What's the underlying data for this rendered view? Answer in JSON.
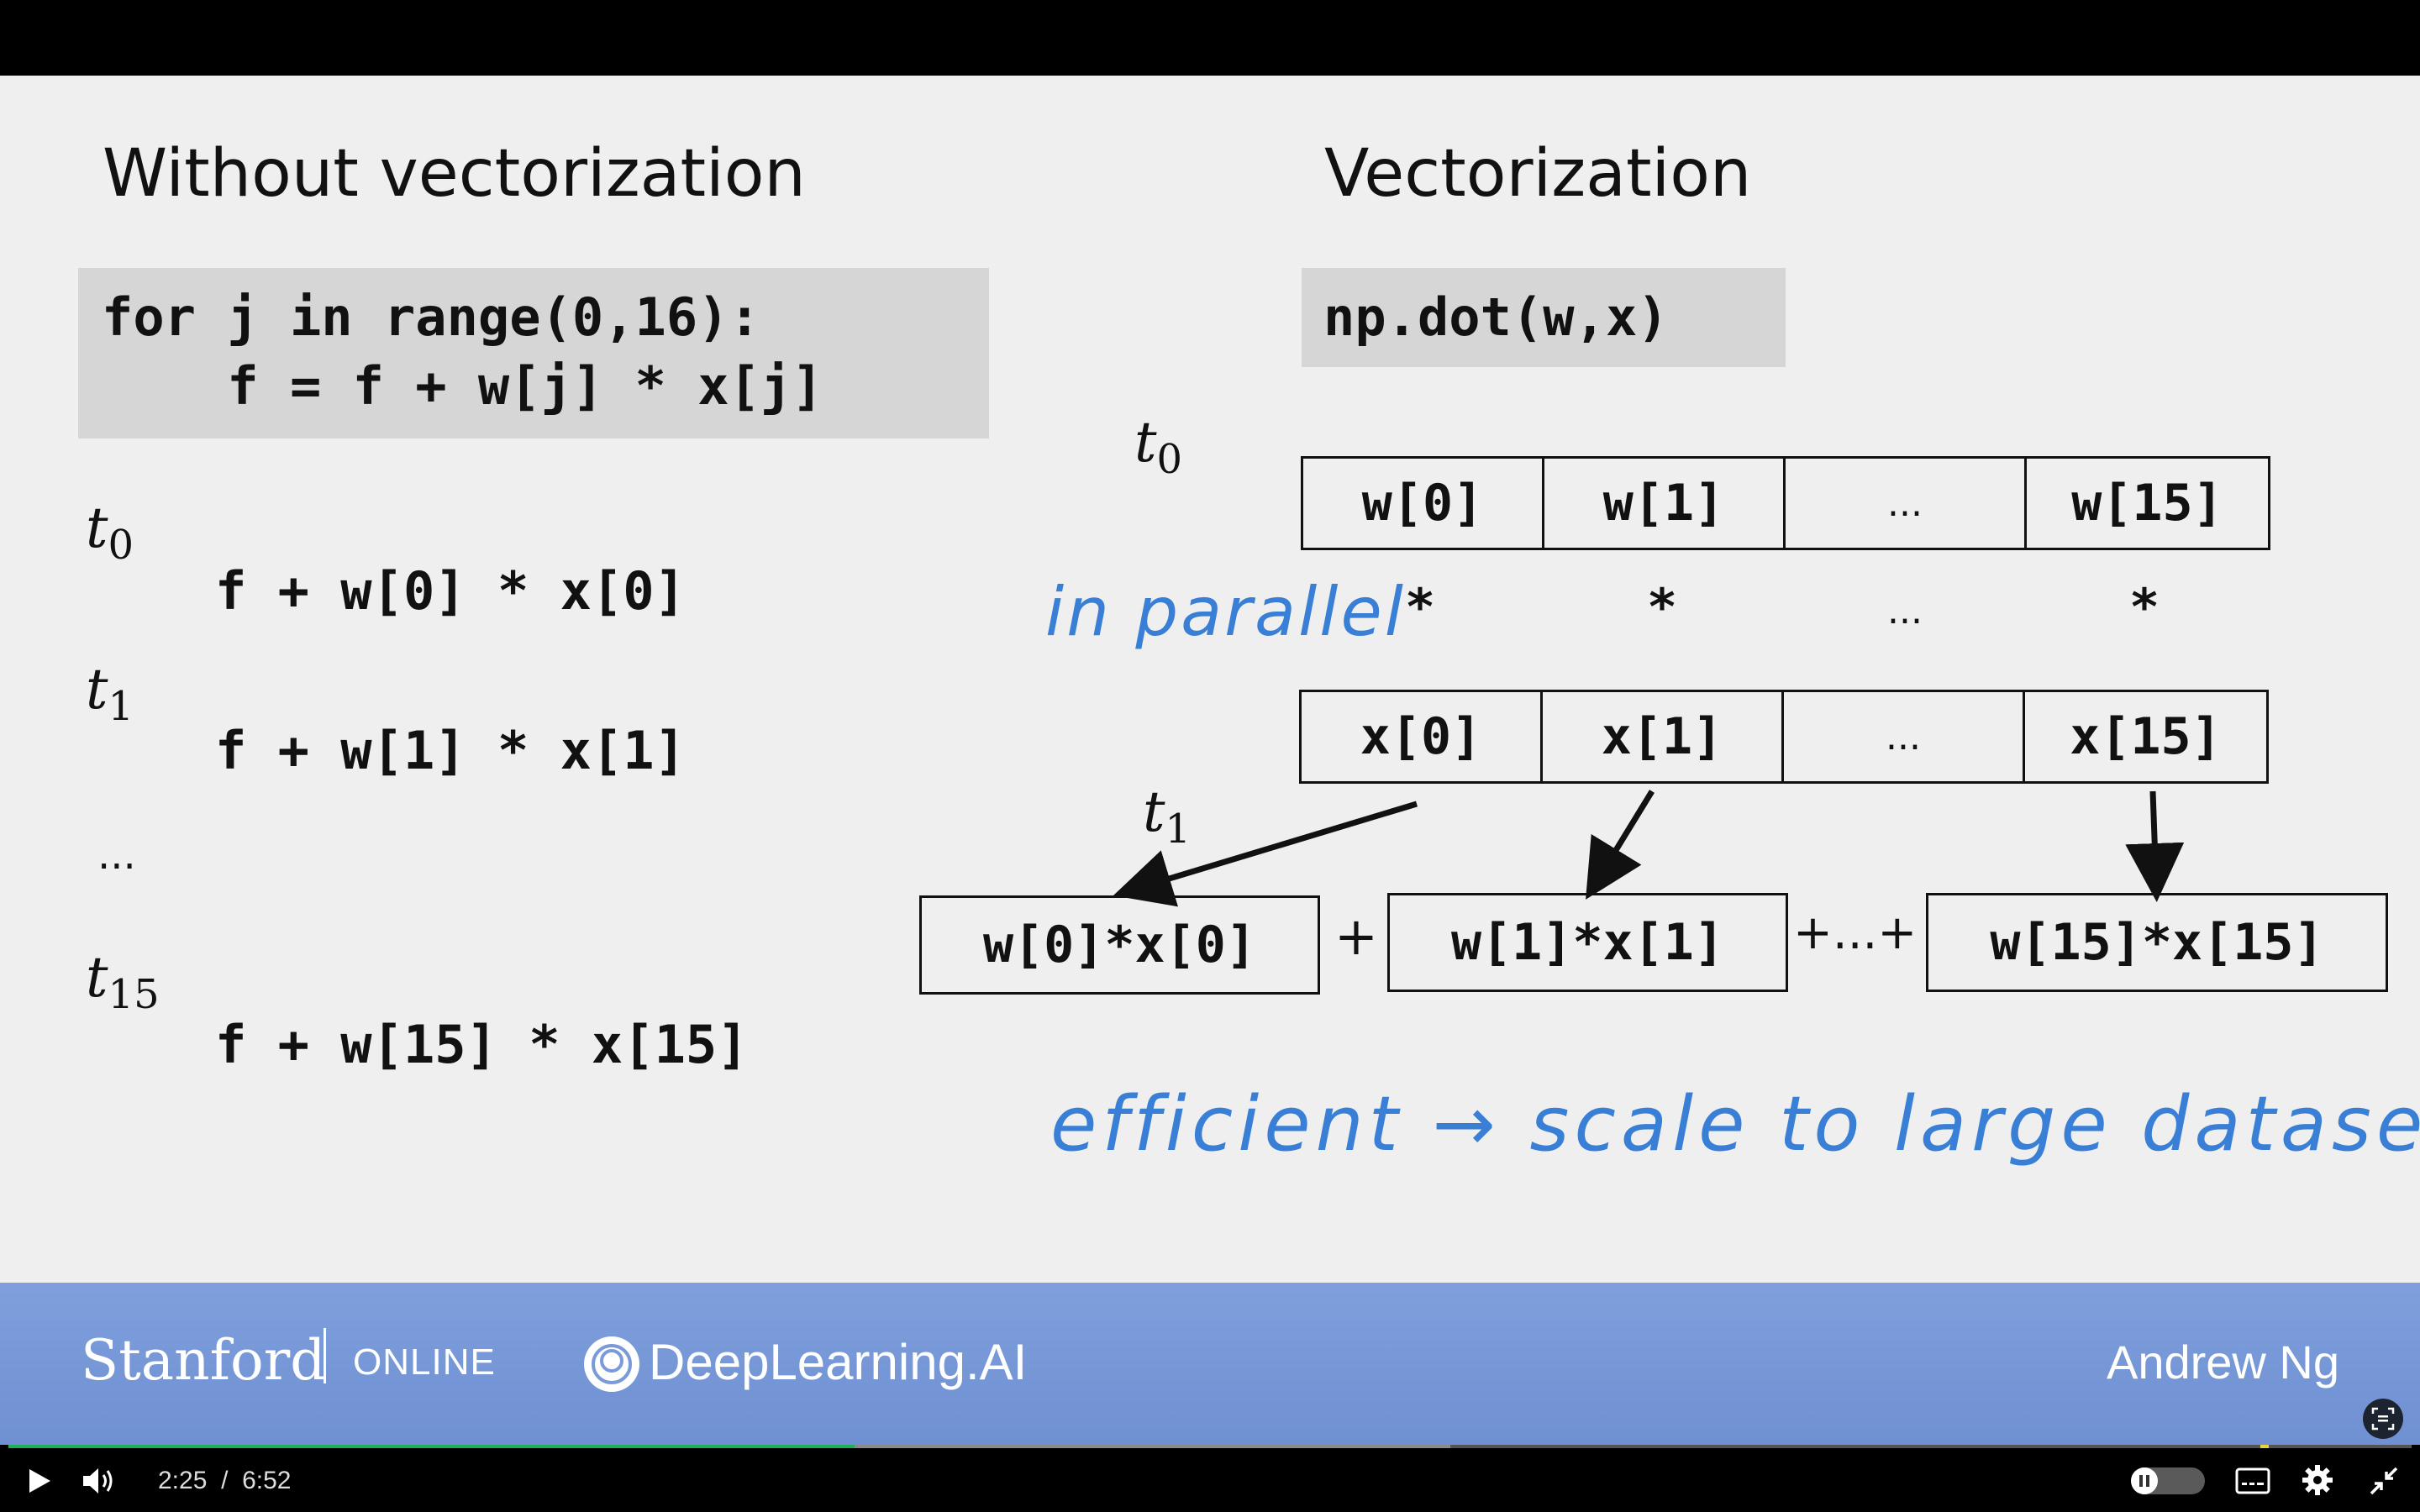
{
  "slide": {
    "left_title": "Without vectorization",
    "right_title": "Vectorization",
    "loop_code": {
      "line1": "for j in range(0,16):",
      "line2": "    f = f + w[j] * x[j]"
    },
    "steps": [
      {
        "t": "t",
        "sub": "0",
        "expr": "f + w[0] * x[0]"
      },
      {
        "t": "t",
        "sub": "1",
        "expr": "f + w[1] * x[1]"
      },
      {
        "t": "t",
        "sub": "15",
        "expr": "f + w[15] * x[15]"
      }
    ],
    "steps_ellipsis": "...",
    "vector_code": "np.dot(w,x)",
    "vec_t0": {
      "t": "t",
      "sub": "0"
    },
    "vec_t1": {
      "t": "t",
      "sub": "1"
    },
    "w_cells": [
      "w[0]",
      "w[1]",
      "...",
      "w[15]"
    ],
    "x_cells": [
      "x[0]",
      "x[1]",
      "...",
      "x[15]"
    ],
    "stars": [
      "*",
      "*",
      "...",
      "*"
    ],
    "products": [
      "w[0]*x[0]",
      "w[1]*x[1]",
      "w[15]*x[15]"
    ],
    "plus_1": "+",
    "plus_2": "+...+",
    "handwritten_parallel": "in parallel",
    "handwritten_efficient": "efficient → scale to large datasets"
  },
  "footer": {
    "stanford": "Stanford",
    "online": "ONLINE",
    "deeplearning": "DeepLearning.AI",
    "author": "Andrew Ng"
  },
  "player": {
    "current_time": "2:25",
    "separator": "/",
    "duration": "6:52",
    "played_fraction": 0.352,
    "buffered_fraction": 0.6
  },
  "colors": {
    "handwriting": "#3a7fd6",
    "footer_blue": "#7a9ad9",
    "progress_green": "#1fae5a"
  }
}
